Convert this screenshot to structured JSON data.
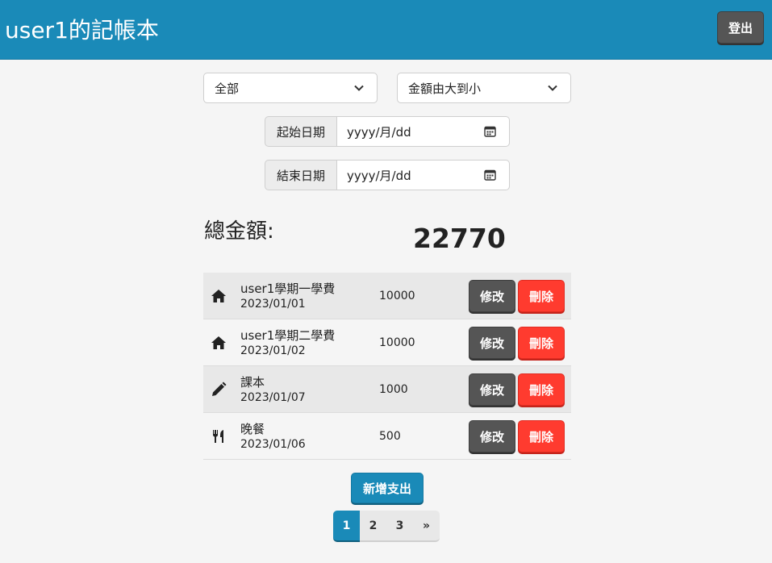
{
  "header": {
    "title": "user1的記帳本",
    "logout_label": "登出"
  },
  "filters": {
    "category": {
      "selected": "全部"
    },
    "sort": {
      "selected": "金額由大到小"
    },
    "start_date": {
      "label": "起始日期",
      "placeholder": "yyyy/月/dd"
    },
    "end_date": {
      "label": "結束日期",
      "placeholder": "yyyy/月/dd"
    }
  },
  "summary": {
    "total_label": "總金額:",
    "total_value": "22770"
  },
  "expenses": [
    {
      "icon": "home-icon",
      "name": "user1學期一學費",
      "date": "2023/01/01",
      "amount": "10000",
      "edit_label": "修改",
      "delete_label": "刪除"
    },
    {
      "icon": "home-icon",
      "name": "user1學期二學費",
      "date": "2023/01/02",
      "amount": "10000",
      "edit_label": "修改",
      "delete_label": "刪除"
    },
    {
      "icon": "pencil-icon",
      "name": "課本",
      "date": "2023/01/07",
      "amount": "1000",
      "edit_label": "修改",
      "delete_label": "刪除"
    },
    {
      "icon": "utensils-icon",
      "name": "晚餐",
      "date": "2023/01/06",
      "amount": "500",
      "edit_label": "修改",
      "delete_label": "刪除"
    }
  ],
  "add_button_label": "新增支出",
  "pagination": {
    "pages": [
      "1",
      "2",
      "3"
    ],
    "next": "»",
    "current": "1"
  },
  "colors": {
    "primary": "#1a8ab8",
    "danger": "#ff3b2f",
    "dark": "#555555",
    "background": "#f5f5f5"
  }
}
